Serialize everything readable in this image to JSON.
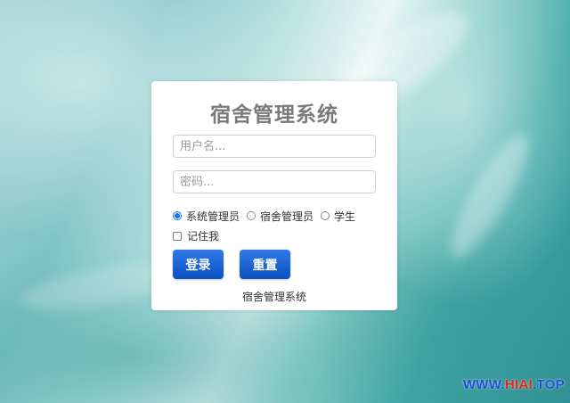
{
  "login": {
    "title": "宿舍管理系统",
    "username_placeholder": "用户名...",
    "password_placeholder": "密码...",
    "roles": [
      {
        "label": "系统管理员",
        "selected": true
      },
      {
        "label": "宿舍管理员",
        "selected": false
      },
      {
        "label": "学生",
        "selected": false
      }
    ],
    "remember_label": "记住我",
    "login_button": "登录",
    "reset_button": "重置",
    "footer": "宿舍管理系统"
  },
  "watermark": {
    "prefix": "WWW.",
    "highlight": "HIAI",
    "suffix": ".TOP"
  },
  "colors": {
    "button": "#1a5fd0",
    "radio_selected": "#1a73e8",
    "title": "#7a7a7a"
  }
}
